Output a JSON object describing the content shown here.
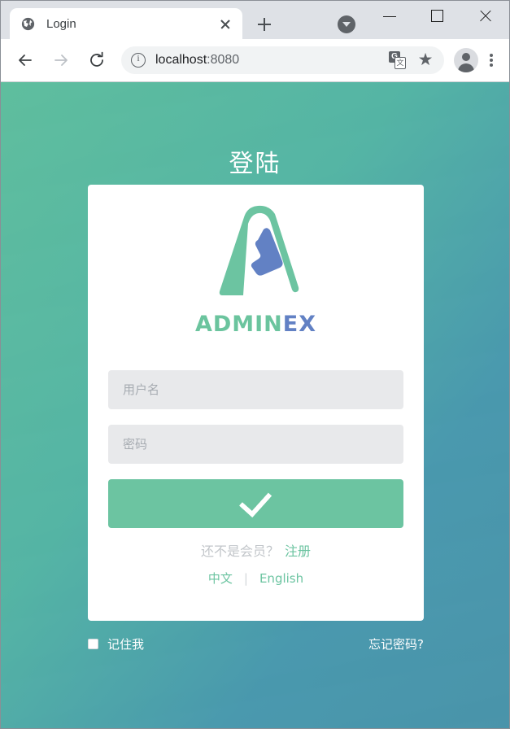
{
  "browser": {
    "tab": {
      "title": "Login",
      "favicon": "globe-icon",
      "close": "close-icon"
    },
    "new_tab": "+",
    "tab_search": "tab-search-icon",
    "window_controls": {
      "minimize": "—",
      "maximize": "□",
      "close": "✕"
    },
    "nav": {
      "back": "back-arrow-icon",
      "forward": "forward-arrow-icon",
      "reload": "reload-icon"
    },
    "omnibox": {
      "site_info": "info-icon",
      "url_host": "localhost",
      "url_port": ":8080",
      "translate": "translate-icon",
      "translate_glyph": "G",
      "bookmark": "★"
    },
    "profile": "profile-avatar-icon",
    "menu": "kebab-menu-icon"
  },
  "page": {
    "title": "登陆",
    "logo": {
      "mark": "adminex-logo-mark",
      "word_primary": "ADMIN",
      "word_secondary": "EX"
    },
    "form": {
      "username_placeholder": "用户名",
      "username_value": "",
      "password_placeholder": "密码",
      "password_value": "",
      "submit_icon": "checkmark-icon"
    },
    "signup": {
      "prompt": "还不是会员？",
      "link": "注册"
    },
    "language": {
      "chinese": "中文",
      "separator": "|",
      "english": "English"
    },
    "remember_me": "记住我",
    "forgot_password": "忘记密码?"
  },
  "colors": {
    "brand_green": "#6cc4a1",
    "brand_blue": "#6281c4",
    "bg_gradient_start": "#5fbe9e",
    "bg_gradient_end": "#4891ab",
    "card_bg": "#ffffff",
    "field_bg": "#e8e9eb"
  }
}
